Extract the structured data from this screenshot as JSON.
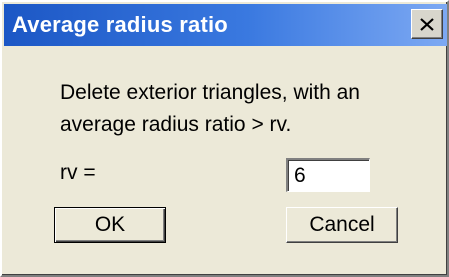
{
  "window": {
    "title": "Average radius ratio",
    "close_icon": "close-icon"
  },
  "message": {
    "line1": "Delete exterior triangles, with an",
    "line2": "average radius ratio > rv."
  },
  "rv_field": {
    "label": "rv =",
    "value": "6"
  },
  "buttons": {
    "ok": "OK",
    "cancel": "Cancel"
  },
  "colors": {
    "title_bar_start": "#1c57c5",
    "title_bar_end": "#7da9f3",
    "dialog_background": "#ece9d8"
  }
}
